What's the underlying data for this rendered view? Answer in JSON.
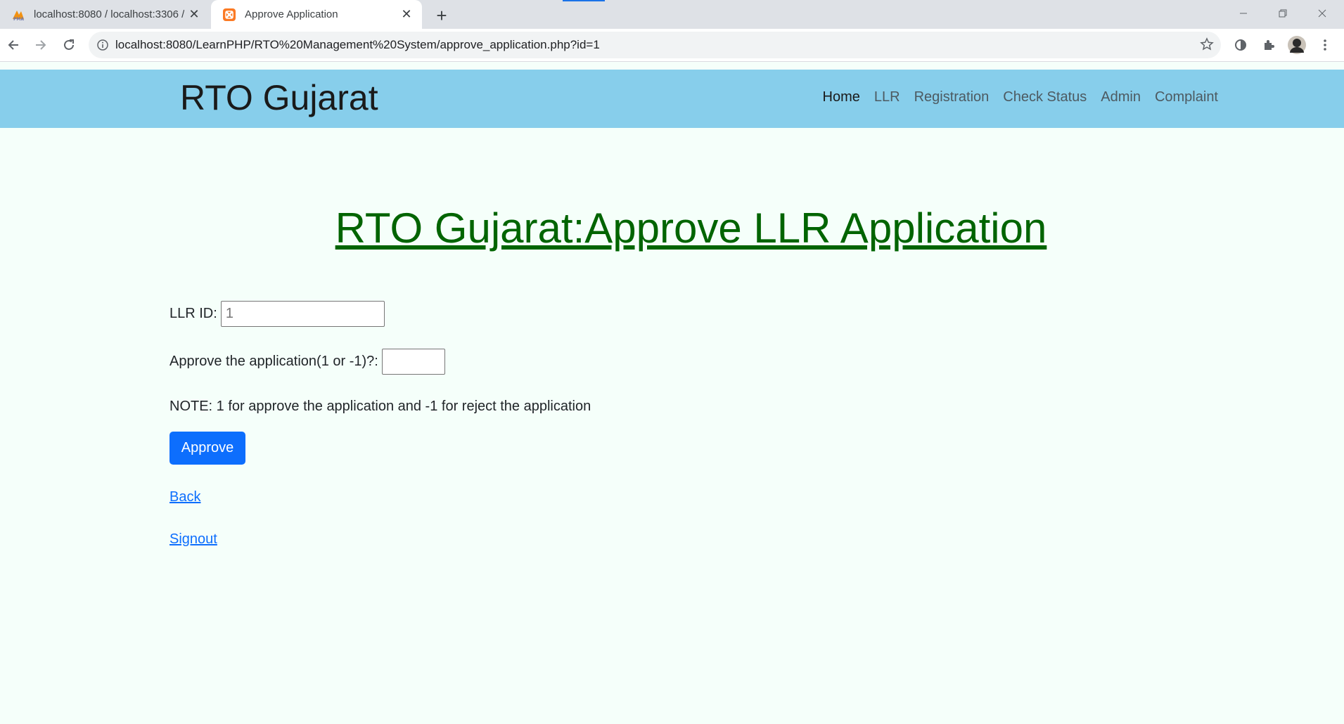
{
  "browser": {
    "tabs": [
      {
        "title": "localhost:8080 / localhost:3306 /",
        "favicon": "phpmyadmin-icon",
        "active": false
      },
      {
        "title": "Approve Application",
        "favicon": "xampp-icon",
        "active": true
      }
    ],
    "new_tab_label": "+",
    "url": "localhost:8080/LearnPHP/RTO%20Management%20System/approve_application.php?id=1"
  },
  "header": {
    "brand": "RTO Gujarat",
    "nav": [
      {
        "label": "Home",
        "active": true
      },
      {
        "label": "LLR",
        "active": false
      },
      {
        "label": "Registration",
        "active": false
      },
      {
        "label": "Check Status",
        "active": false
      },
      {
        "label": "Admin",
        "active": false
      },
      {
        "label": "Complaint",
        "active": false
      }
    ]
  },
  "main": {
    "title": "RTO Gujarat:Approve LLR Application",
    "llr_id": {
      "label": "LLR ID:",
      "value": "1"
    },
    "approve_field": {
      "label": "Approve the application(1 or -1)?:",
      "value": ""
    },
    "note": "NOTE: 1 for approve the application and -1 for reject the application",
    "approve_button": "Approve",
    "back_link": "Back",
    "signout_link": "Signout"
  },
  "colors": {
    "header_bg": "#87ceeb",
    "page_bg": "#f5fffa",
    "title_color": "#006400",
    "button_bg": "#0d6efd",
    "link_color": "#0d6efd"
  }
}
